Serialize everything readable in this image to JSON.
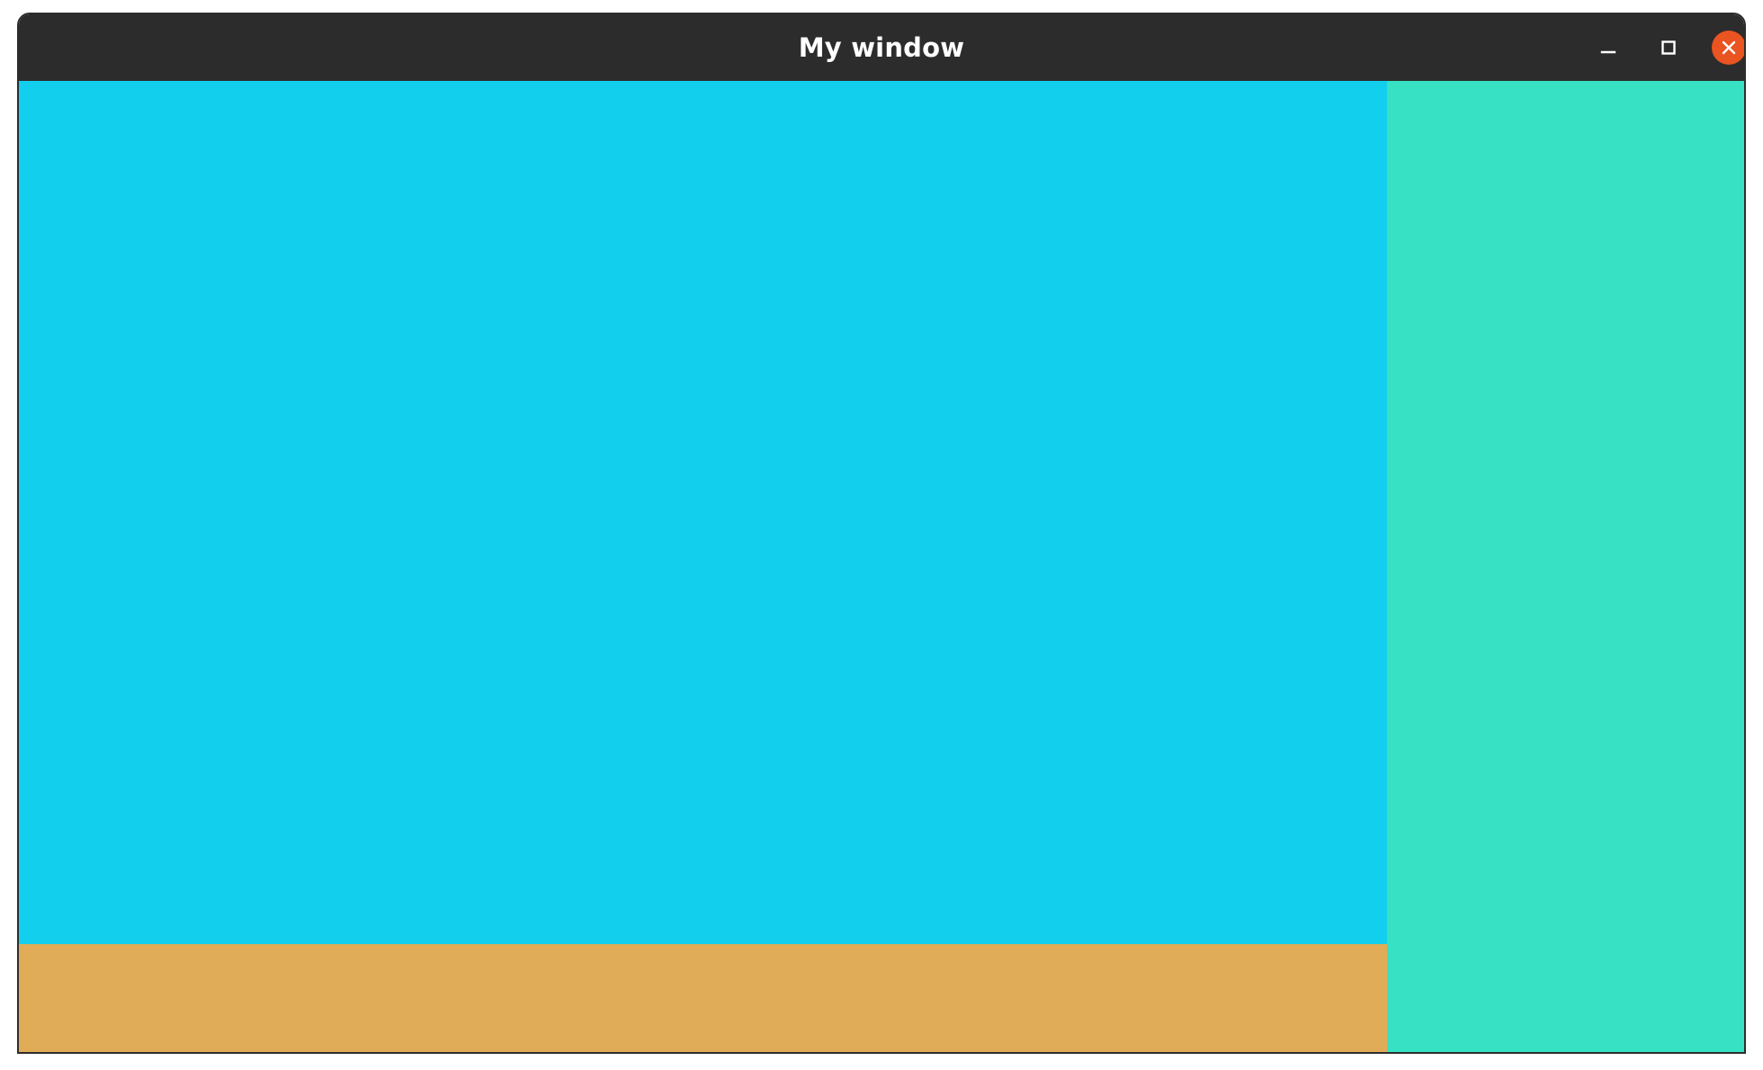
{
  "window": {
    "title": "My window"
  },
  "controls": {
    "minimize_icon": "minimize-icon",
    "maximize_icon": "maximize-icon",
    "close_icon": "close-icon",
    "close_color": "#e95420"
  },
  "panels": {
    "main_color": "#13cfee",
    "bottom_color": "#e0ac57",
    "right_color": "#36e2c3"
  }
}
